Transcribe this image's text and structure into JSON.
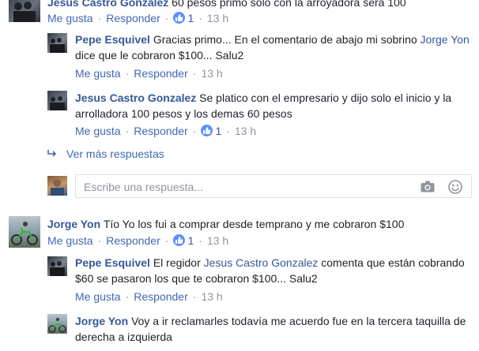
{
  "actions": {
    "like": "Me gusta",
    "reply": "Responder",
    "separator": "·"
  },
  "comments": [
    {
      "author": "Jesus Castro Gonzalez",
      "text": "60 pesos primo solo con la arroyadora sera 100",
      "likes": "1",
      "time": "13 h"
    },
    {
      "author": "Pepe Esquivel",
      "text_before": "Gracias primo... En el comentario de abajo mi sobrino ",
      "mention": "Jorge Yon",
      "text_after": " dice que le cobraron $100... Salu2",
      "time": "13 h"
    },
    {
      "author": "Jesus Castro Gonzalez",
      "text": "Se platico con el empresario y dijo solo el inicio y la arrolladora 100 pesos y los demas 60 pesos",
      "likes": "1",
      "time": "13 h"
    },
    {
      "author": "Jorge Yon",
      "text": "Tío Yo los fui a comprar desde temprano y me cobraron $100",
      "likes": "1",
      "time": "13 h"
    },
    {
      "author": "Pepe Esquivel",
      "text_before": "El regidor ",
      "mention": "Jesus Castro Gonzalez",
      "text_after": " comenta que están cobrando $60 se pasaron los que te cobraron $100... Salu2",
      "time": "13 h"
    },
    {
      "author": "Jorge Yon",
      "text": "Voy a ir reclamarles todavía me acuerdo fue en la tercera taquilla de derecha a izquierda"
    }
  ],
  "more_replies": "Ver más respuestas",
  "reply_input": {
    "placeholder": "Escribe una respuesta..."
  },
  "icons": {
    "like": "thumbs-up-icon",
    "camera": "camera-icon",
    "emoji": "smiley-icon",
    "more_replies": "reply-arrow-icon"
  },
  "colors": {
    "link": "#365899",
    "action": "#4267b2",
    "muted": "#90949c",
    "like_badge": "#5890ff"
  }
}
